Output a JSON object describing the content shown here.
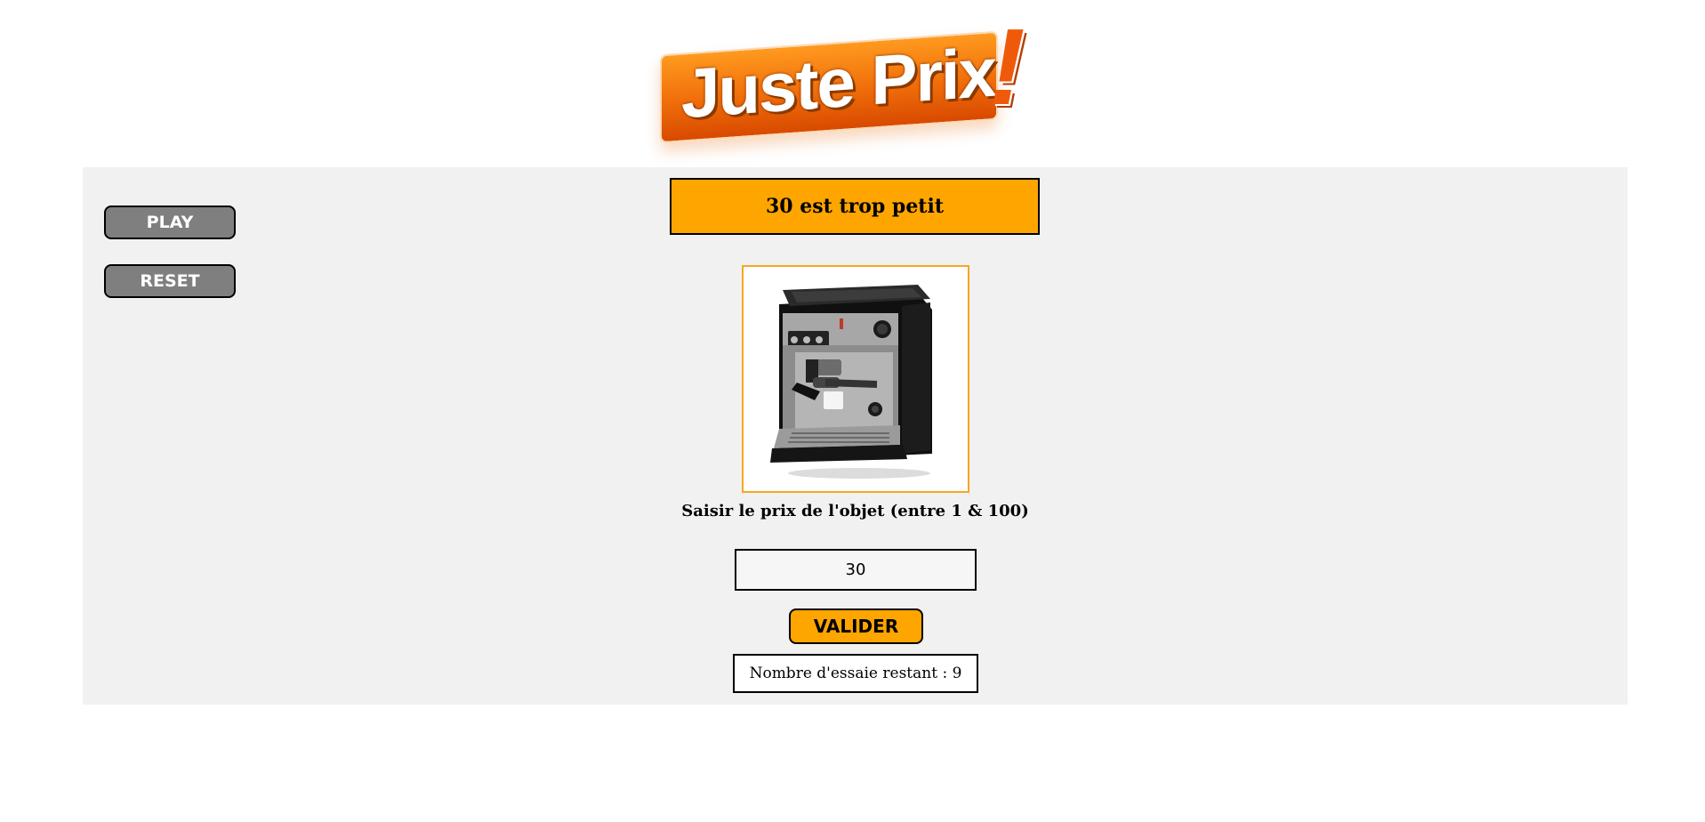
{
  "logo": {
    "title": "Juste Prix",
    "exclamation": "!"
  },
  "buttons": {
    "play_label": "PLAY",
    "reset_label": "RESET",
    "valider_label": "VALIDER"
  },
  "message": "30 est trop petit",
  "product": {
    "image_icon": "espresso-machine-icon"
  },
  "prompt": "Saisir le prix de l'objet (entre 1 & 100)",
  "price_input": {
    "value": "30"
  },
  "tries": "Nombre d'essaie restant : 9",
  "colors": {
    "accent": "#ffa500",
    "panel": "#f1f1f1",
    "button_grey": "#7f7f7f",
    "logo_orange": "#f06d0a"
  }
}
